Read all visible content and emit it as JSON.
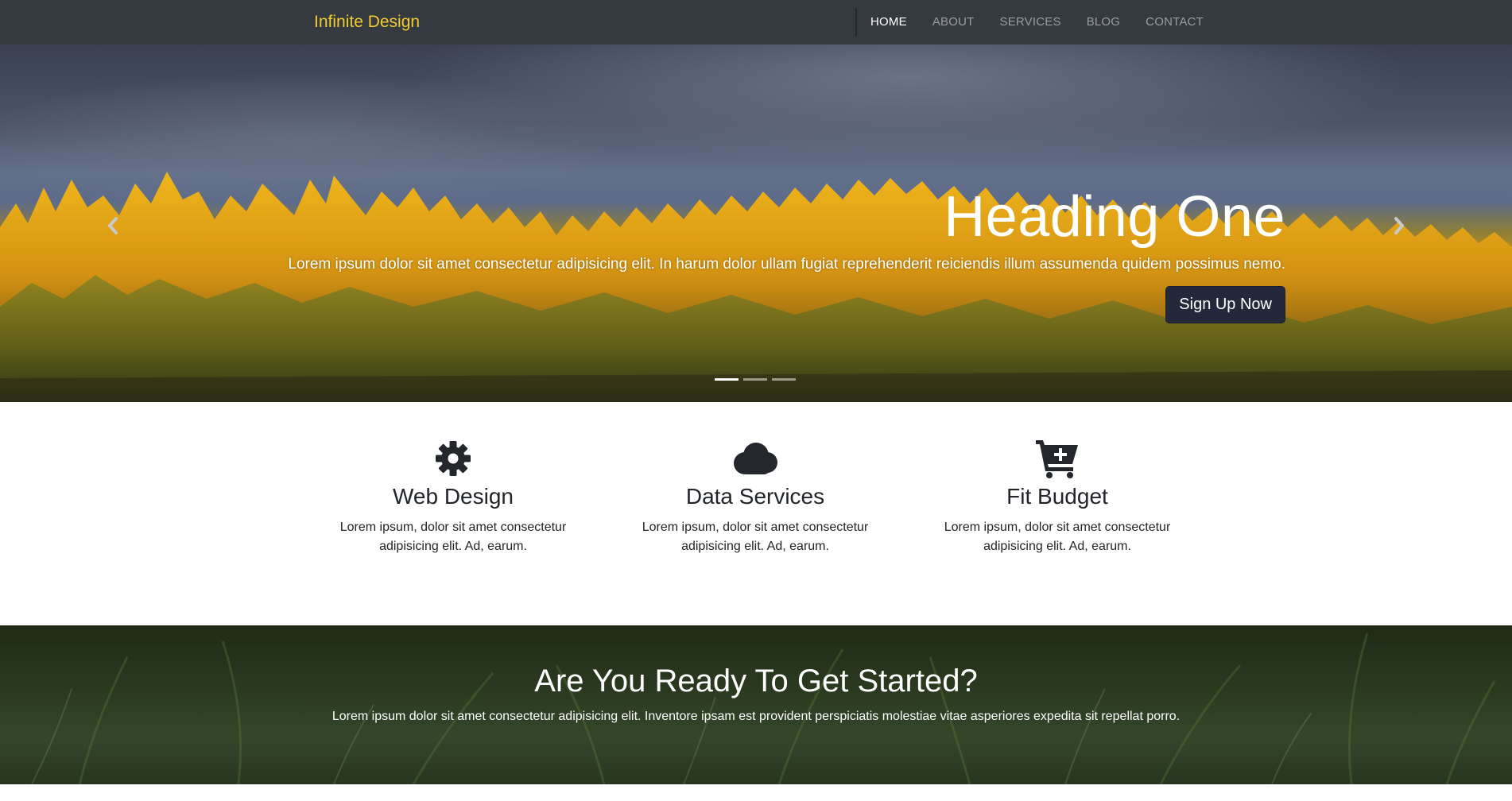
{
  "navbar": {
    "brand": "Infinite Design",
    "links": [
      {
        "label": "HOME",
        "active": true
      },
      {
        "label": "ABOUT",
        "active": false
      },
      {
        "label": "SERVICES",
        "active": false
      },
      {
        "label": "BLOG",
        "active": false
      },
      {
        "label": "CONTACT",
        "active": false
      }
    ]
  },
  "hero": {
    "heading": "Heading One",
    "text": "Lorem ipsum dolor sit amet consectetur adipisicing elit. In harum dolor ullam fugiat reprehenderit reiciendis illum assumenda quidem possimus nemo.",
    "button": "Sign Up Now",
    "prev_icon": "chevron-left-icon",
    "next_icon": "chevron-right-icon",
    "slide_count": 3,
    "active_slide": 1
  },
  "features": [
    {
      "icon": "gear-icon",
      "title": "Web Design",
      "text": "Lorem ipsum, dolor sit amet consectetur adipisicing elit. Ad, earum."
    },
    {
      "icon": "cloud-icon",
      "title": "Data Services",
      "text": "Lorem ipsum, dolor sit amet consectetur adipisicing elit. Ad, earum."
    },
    {
      "icon": "cart-plus-icon",
      "title": "Fit Budget",
      "text": "Lorem ipsum, dolor sit amet consectetur adipisicing elit. Ad, earum."
    }
  ],
  "cta": {
    "title": "Are You Ready To Get Started?",
    "text": "Lorem ipsum dolor sit amet consectetur adipisicing elit. Inventore ipsam est provident perspiciatis molestiae vitae asperiores expedita sit repellat porro."
  },
  "colors": {
    "navbar_bg": "#343a40",
    "brand": "#f3cc2f",
    "button_bg": "#23293a",
    "text_dark": "#212529"
  }
}
